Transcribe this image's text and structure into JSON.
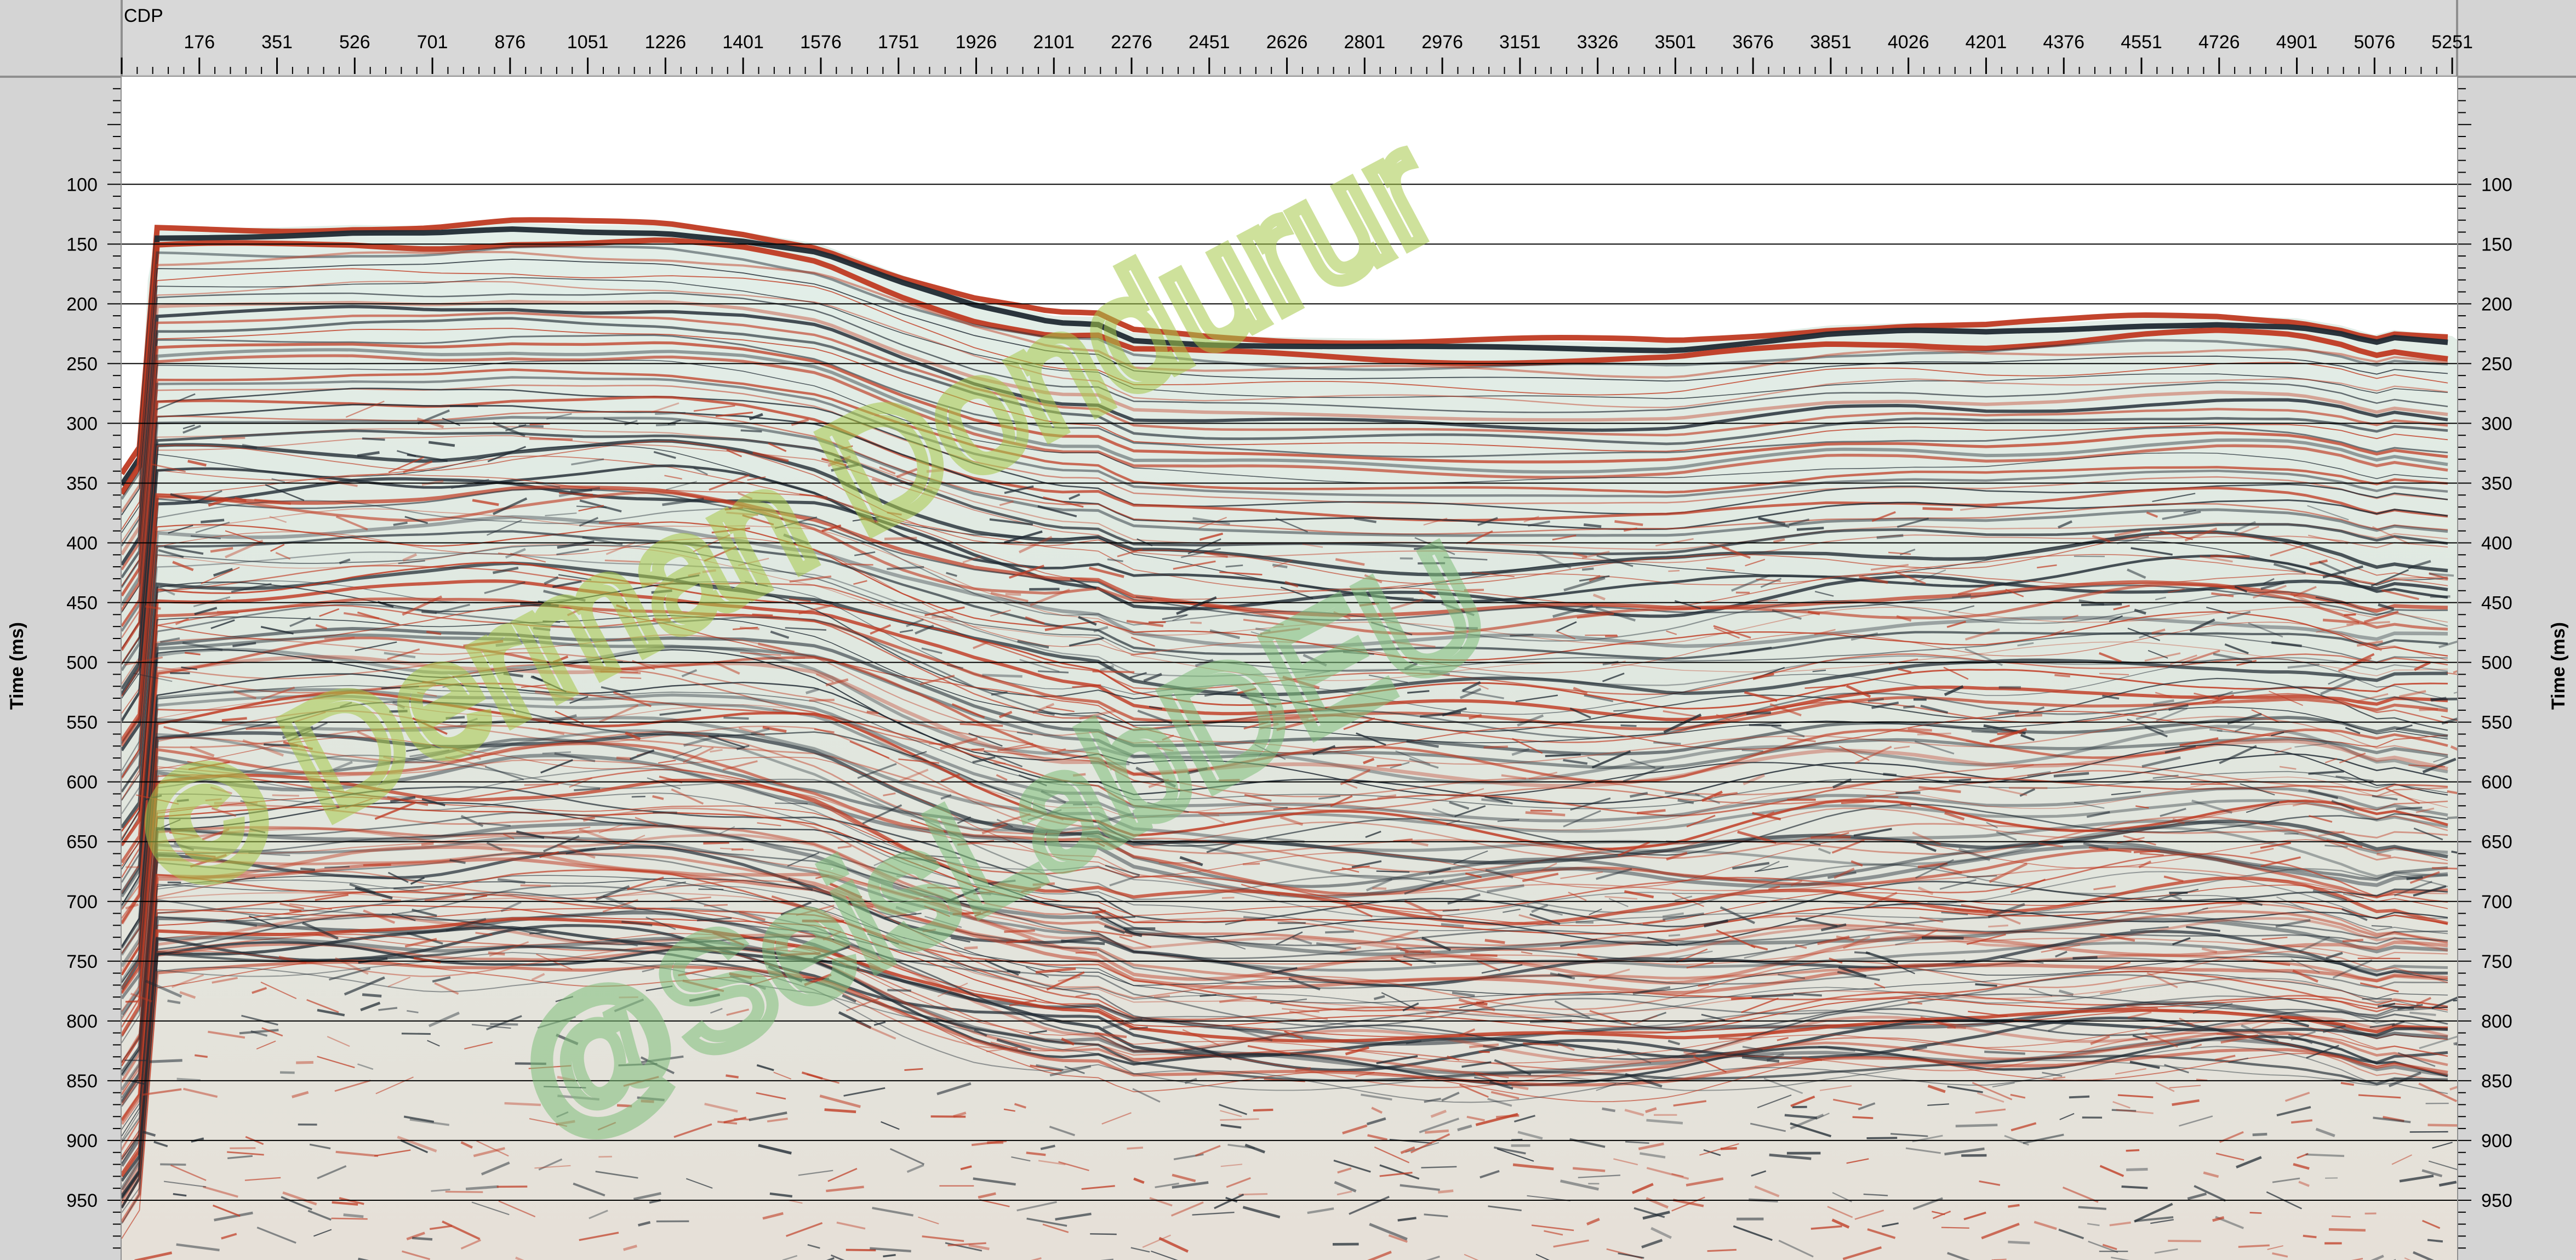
{
  "chart_data": {
    "type": "heatmap",
    "title": "",
    "xlabel": "CDP",
    "ylabel": "Time (ms)",
    "ylabel_right": "Time (ms)",
    "x_ticks": [
      1,
      176,
      351,
      526,
      701,
      876,
      1051,
      1226,
      1401,
      1576,
      1751,
      1926,
      2101,
      2276,
      2451,
      2626,
      2801,
      2976,
      3151,
      3326,
      3501,
      3676,
      3851,
      4026,
      4201,
      4376,
      4551,
      4726,
      4901,
      5076,
      5251
    ],
    "x_tick_labels": [
      "",
      "176",
      "351",
      "526",
      "701",
      "876",
      "1051",
      "1226",
      "1401",
      "1576",
      "1751",
      "1926",
      "2101",
      "2276",
      "2451",
      "2626",
      "2801",
      "2976",
      "3151",
      "3326",
      "3501",
      "3676",
      "3851",
      "4026",
      "4201",
      "4376",
      "4551",
      "4726",
      "4901",
      "5076",
      "5251"
    ],
    "xlim": [
      1,
      5262
    ],
    "y_ticks": [
      100,
      150,
      200,
      250,
      300,
      350,
      400,
      450,
      500,
      550,
      600,
      650,
      700,
      750,
      800,
      850,
      900,
      950
    ],
    "ylim": [
      10,
      1000
    ],
    "y_minor_step": 10,
    "grid": "horizontal lines every 50 ms",
    "seafloor_ms": [
      {
        "x": 1,
        "y": 345
      },
      {
        "x": 40,
        "y": 330
      },
      {
        "x": 60,
        "y": 180
      },
      {
        "x": 80,
        "y": 138
      },
      {
        "x": 351,
        "y": 136
      },
      {
        "x": 526,
        "y": 134
      },
      {
        "x": 701,
        "y": 135
      },
      {
        "x": 876,
        "y": 132
      },
      {
        "x": 1051,
        "y": 134
      },
      {
        "x": 1226,
        "y": 134
      },
      {
        "x": 1401,
        "y": 140
      },
      {
        "x": 1576,
        "y": 150
      },
      {
        "x": 1751,
        "y": 175
      },
      {
        "x": 1926,
        "y": 196
      },
      {
        "x": 2101,
        "y": 210
      },
      {
        "x": 2200,
        "y": 211
      },
      {
        "x": 2276,
        "y": 224
      },
      {
        "x": 2451,
        "y": 227
      },
      {
        "x": 2626,
        "y": 228
      },
      {
        "x": 2801,
        "y": 229
      },
      {
        "x": 2976,
        "y": 230
      },
      {
        "x": 3151,
        "y": 231
      },
      {
        "x": 3326,
        "y": 232
      },
      {
        "x": 3501,
        "y": 232
      },
      {
        "x": 3676,
        "y": 225
      },
      {
        "x": 3851,
        "y": 218
      },
      {
        "x": 4026,
        "y": 216
      },
      {
        "x": 4201,
        "y": 218
      },
      {
        "x": 4376,
        "y": 216
      },
      {
        "x": 4551,
        "y": 212
      },
      {
        "x": 4726,
        "y": 210
      },
      {
        "x": 4901,
        "y": 212
      },
      {
        "x": 5000,
        "y": 218
      },
      {
        "x": 5076,
        "y": 226
      },
      {
        "x": 5120,
        "y": 222
      },
      {
        "x": 5251,
        "y": 227
      },
      {
        "x": 5262,
        "y": 230
      }
    ],
    "wiggle_colors": {
      "positive": "#bf3a22",
      "negative": "#202a33",
      "background": "#dfeee9"
    }
  },
  "watermark": {
    "line1": "© Derman Dondurur",
    "line2": "@SeisLabDEU",
    "colors": [
      "#a7c94a",
      "#d9d06a",
      "#7fbf7a"
    ]
  }
}
